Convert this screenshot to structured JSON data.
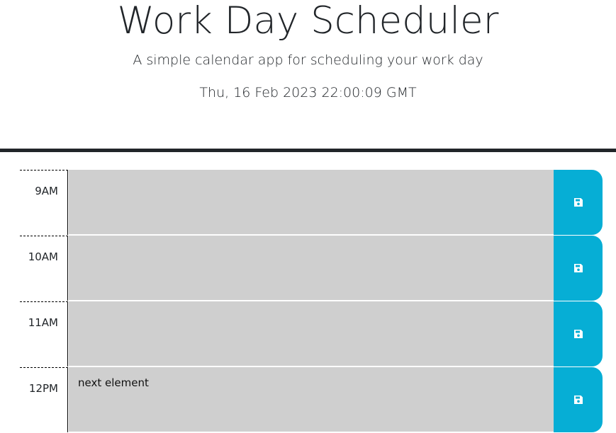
{
  "header": {
    "title": "Work Day Scheduler",
    "subtitle": "A simple calendar app for scheduling your work day",
    "current_date": "Thu, 16 Feb 2023 22:00:09 GMT"
  },
  "rows": [
    {
      "hour": "9AM",
      "description": "",
      "save_icon": "floppy-disk-icon"
    },
    {
      "hour": "10AM",
      "description": "",
      "save_icon": "floppy-disk-icon"
    },
    {
      "hour": "11AM",
      "description": "",
      "save_icon": "floppy-disk-icon"
    },
    {
      "hour": "12PM",
      "description": "next element",
      "save_icon": "floppy-disk-icon"
    }
  ],
  "colors": {
    "past_block": "#cfcfcf",
    "save_button": "#06aed5",
    "header_border": "#212529"
  }
}
